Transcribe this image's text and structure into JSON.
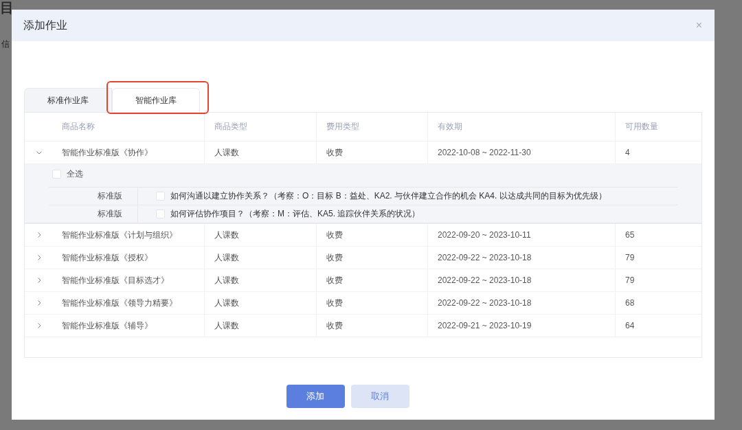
{
  "background_page": {
    "title": "目",
    "tab": "信"
  },
  "dialog": {
    "title": "添加作业",
    "close": "×"
  },
  "tabs": [
    {
      "label": "标准作业库",
      "selected": false
    },
    {
      "label": "智能作业库",
      "selected": true,
      "highlighted": true
    }
  ],
  "table": {
    "columns": [
      "商品名称",
      "商品类型",
      "费用类型",
      "有效期",
      "可用数量"
    ],
    "rows": [
      {
        "name": "智能作业标准版《协作》",
        "type": "人课数",
        "fee": "收费",
        "validity": "2022-10-08 ~ 2022-11-30",
        "quantity": "4",
        "expanded": true,
        "select_all": {
          "label": "全选",
          "checked": false
        },
        "children": [
          {
            "edition": "标准版",
            "checked": false,
            "question": "如何沟通以建立协作关系？（考察：O：目标 B：益处、KA2. 与伙伴建立合作的机会 KA4. 以达成共同的目标为优先级）"
          },
          {
            "edition": "标准版",
            "checked": false,
            "question": "如何评估协作项目？（考察：M：评估、KA5. 追踪伙伴关系的状况）"
          }
        ]
      },
      {
        "name": "智能作业标准版《计划与组织》",
        "type": "人课数",
        "fee": "收费",
        "validity": "2022-09-20 ~ 2023-10-11",
        "quantity": "65",
        "expanded": false
      },
      {
        "name": "智能作业标准版《授权》",
        "type": "人课数",
        "fee": "收费",
        "validity": "2022-09-22 ~ 2023-10-18",
        "quantity": "79",
        "expanded": false
      },
      {
        "name": "智能作业标准版《目标选才》",
        "type": "人课数",
        "fee": "收费",
        "validity": "2022-09-22 ~ 2023-10-18",
        "quantity": "79",
        "expanded": false
      },
      {
        "name": "智能作业标准版《领导力精要》",
        "type": "人课数",
        "fee": "收费",
        "validity": "2022-09-22 ~ 2023-10-18",
        "quantity": "68",
        "expanded": false
      },
      {
        "name": "智能作业标准版《辅导》",
        "type": "人课数",
        "fee": "收费",
        "validity": "2022-09-21 ~ 2023-10-19",
        "quantity": "64",
        "expanded": false
      }
    ]
  },
  "buttons": [
    {
      "label": "添加",
      "kind": "primary"
    },
    {
      "label": "取消",
      "kind": "secondary"
    }
  ]
}
